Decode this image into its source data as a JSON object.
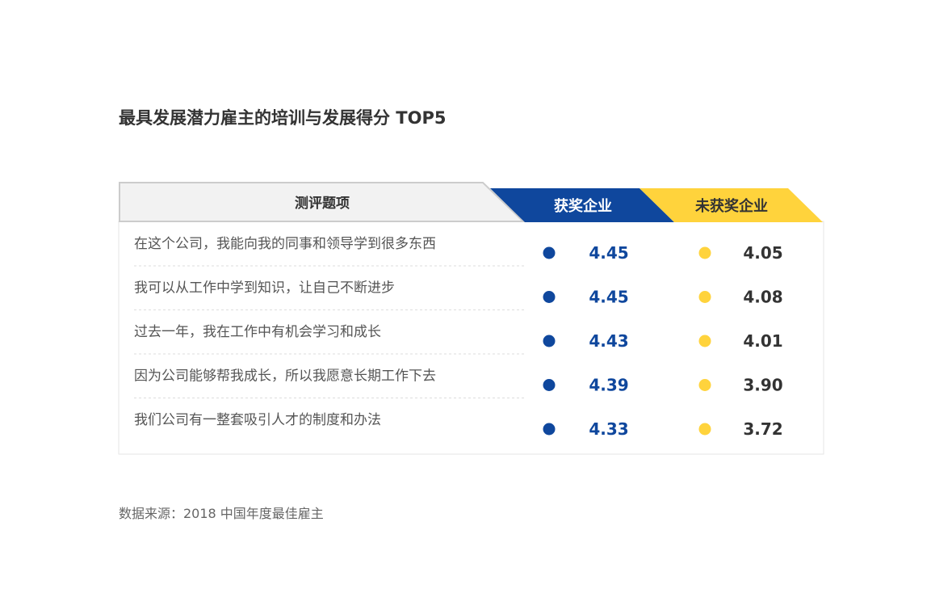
{
  "title": "最具发展潜力雇主的培训与发展得分 TOP5",
  "source": "数据来源：2018 中国年度最佳雇主",
  "colors": {
    "awarded": "#0F479D",
    "not_awarded": "#FFD33C",
    "text": "#333333",
    "muted": "#666666",
    "border": "#E6E6E6"
  },
  "chart_data": {
    "type": "table",
    "columns": [
      "测评题项",
      "获奖企业",
      "未获奖企业"
    ],
    "series": [
      {
        "name": "获奖企业",
        "values": [
          4.45,
          4.45,
          4.43,
          4.39,
          4.33
        ]
      },
      {
        "name": "未获奖企业",
        "values": [
          4.05,
          4.08,
          4.01,
          3.9,
          3.72
        ]
      }
    ],
    "categories": [
      "在这个公司，我能向我的同事和领导学到很多东西",
      "我可以从工作中学到知识，让自己不断进步",
      "过去一年，我在工作中有机会学习和成长",
      "因为公司能够帮我成长，所以我愿意长期工作下去",
      "我们公司有一整套吸引人才的制度和办法"
    ]
  }
}
